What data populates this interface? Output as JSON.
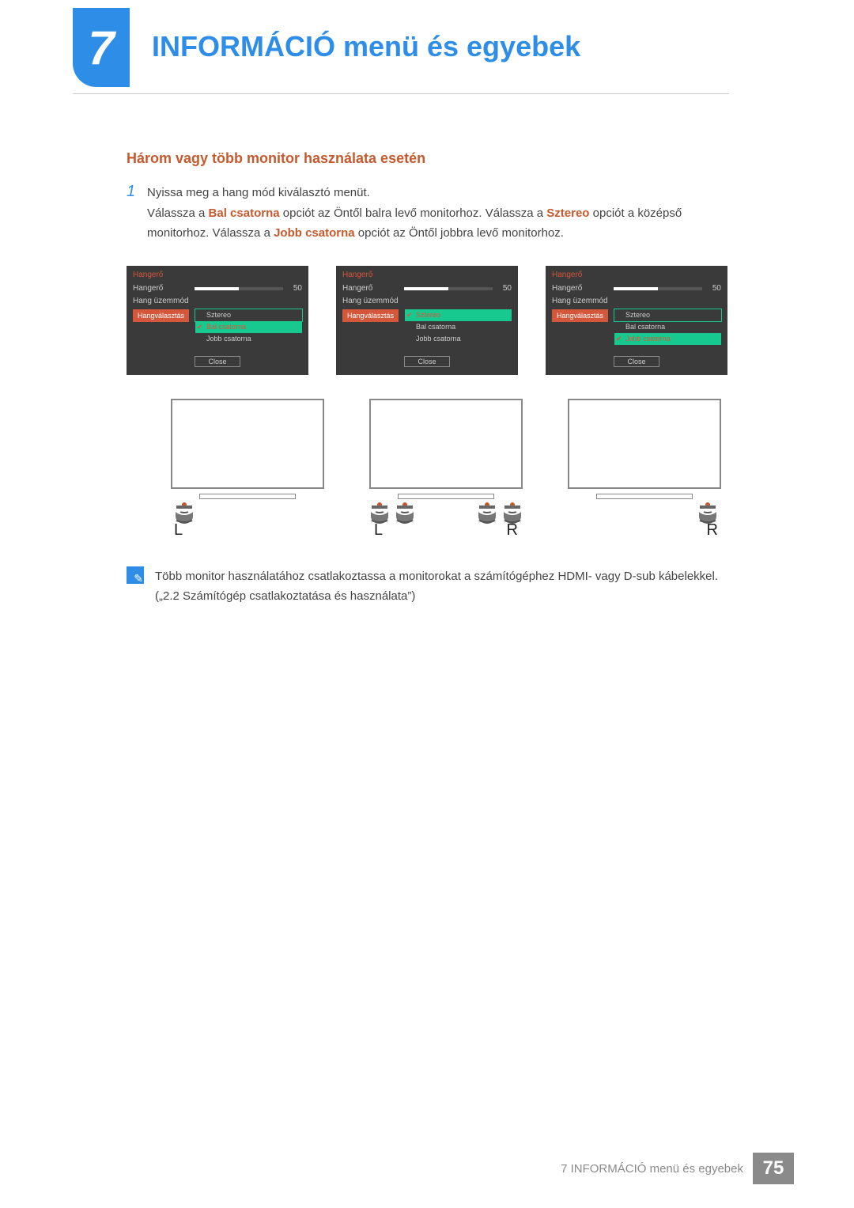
{
  "header": {
    "chapter_number": "7",
    "title": "INFORMÁCIÓ menü és egyebek"
  },
  "section": {
    "title": "Három vagy több monitor használata esetén"
  },
  "step1": {
    "num": "1",
    "line1": "Nyissa meg a hang mód kiválasztó menüt.",
    "line2_a": "Válassza a ",
    "line2_b": "Bal csatorna",
    "line2_c": " opciót az Öntől balra levő monitorhoz. Válassza a ",
    "line2_d": "Sztereo",
    "line2_e": " opciót a középső monitorhoz. Válassza a ",
    "line2_f": "Jobb csatorna",
    "line2_g": " opciót az Öntől jobbra levő monitorhoz."
  },
  "osd": {
    "title": "Hangerő",
    "volume_label": "Hangerő",
    "volume_value": "50",
    "mode_label": "Hang üzemmód",
    "select_label": "Hangválasztás",
    "options": [
      "Sztereo",
      "Bal csatorna",
      "Jobb csatorna"
    ],
    "close": "Close"
  },
  "monitors": {
    "labels": [
      "L",
      "L",
      "R",
      "R"
    ]
  },
  "note": {
    "text": "Több monitor használatához csatlakoztassa a monitorokat a számítógéphez HDMI- vagy D-sub kábelekkel. („2.2 Számítógép csatlakoztatása és használata”)"
  },
  "footer": {
    "text": "7 INFORMÁCIÓ menü és egyebek",
    "page": "75"
  }
}
